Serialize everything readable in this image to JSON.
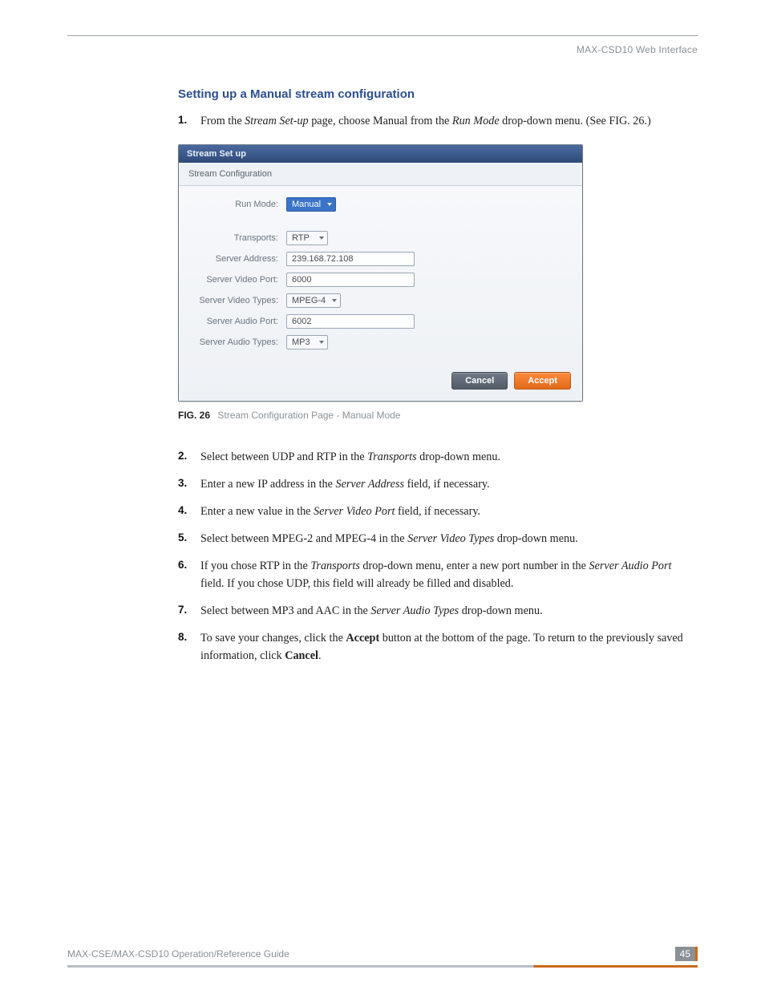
{
  "header": {
    "right_text": "MAX-CSD10 Web Interface"
  },
  "section": {
    "title": "Setting up a Manual stream configuration"
  },
  "steps_a": [
    {
      "num": "1.",
      "prefix": "From the ",
      "italic1": "Stream Set-up",
      "mid1": " page, choose Manual from the ",
      "italic2": "Run Mode",
      "suffix": " drop-down menu. (See FIG. 26.)"
    }
  ],
  "figure": {
    "titlebar": "Stream Set up",
    "subbar": "Stream Configuration",
    "rows": {
      "run_mode": {
        "label": "Run Mode:",
        "value": "Manual"
      },
      "transports": {
        "label": "Transports:",
        "value": "RTP"
      },
      "server_address": {
        "label": "Server Address:",
        "value": "239.168.72.108"
      },
      "server_video_port": {
        "label": "Server Video Port:",
        "value": "6000"
      },
      "server_video_types": {
        "label": "Server Video Types:",
        "value": "MPEG-4"
      },
      "server_audio_port": {
        "label": "Server Audio Port:",
        "value": "6002"
      },
      "server_audio_types": {
        "label": "Server Audio Types:",
        "value": "MP3"
      }
    },
    "buttons": {
      "cancel": "Cancel",
      "accept": "Accept"
    },
    "caption_strong": "FIG. 26",
    "caption_text": "Stream Configuration Page - Manual Mode"
  },
  "steps_b": [
    {
      "num": "2.",
      "prefix": "Select between UDP and RTP in the ",
      "italic1": "Transports",
      "suffix": " drop-down menu."
    },
    {
      "num": "3.",
      "prefix": "Enter a new IP address in the ",
      "italic1": "Server Address",
      "suffix": " field, if necessary."
    },
    {
      "num": "4.",
      "prefix": "Enter a new value in the ",
      "italic1": "Server Video Port",
      "suffix": " field, if necessary."
    },
    {
      "num": "5.",
      "prefix": "Select between MPEG-2 and MPEG-4 in the ",
      "italic1": "Server Video Types",
      "suffix": " drop-down menu."
    },
    {
      "num": "6.",
      "prefix": "If you chose RTP in the ",
      "italic1": "Transports",
      "mid1": " drop-down menu, enter a new port number in the ",
      "italic2": "Server Audio Port",
      "suffix": " field. If you chose UDP, this field will already be filled and disabled."
    },
    {
      "num": "7.",
      "prefix": "Select between MP3 and AAC in the ",
      "italic1": "Server Audio Types",
      "suffix": " drop-down menu."
    },
    {
      "num": "8.",
      "prefix": "To save your changes, click the ",
      "bold1": "Accept",
      "mid1": " button at the bottom of the page. To return to the previously saved information, click ",
      "bold2": "Cancel",
      "suffix": "."
    }
  ],
  "footer": {
    "left": "MAX-CSE/MAX-CSD10 Operation/Reference Guide",
    "page": "45"
  }
}
